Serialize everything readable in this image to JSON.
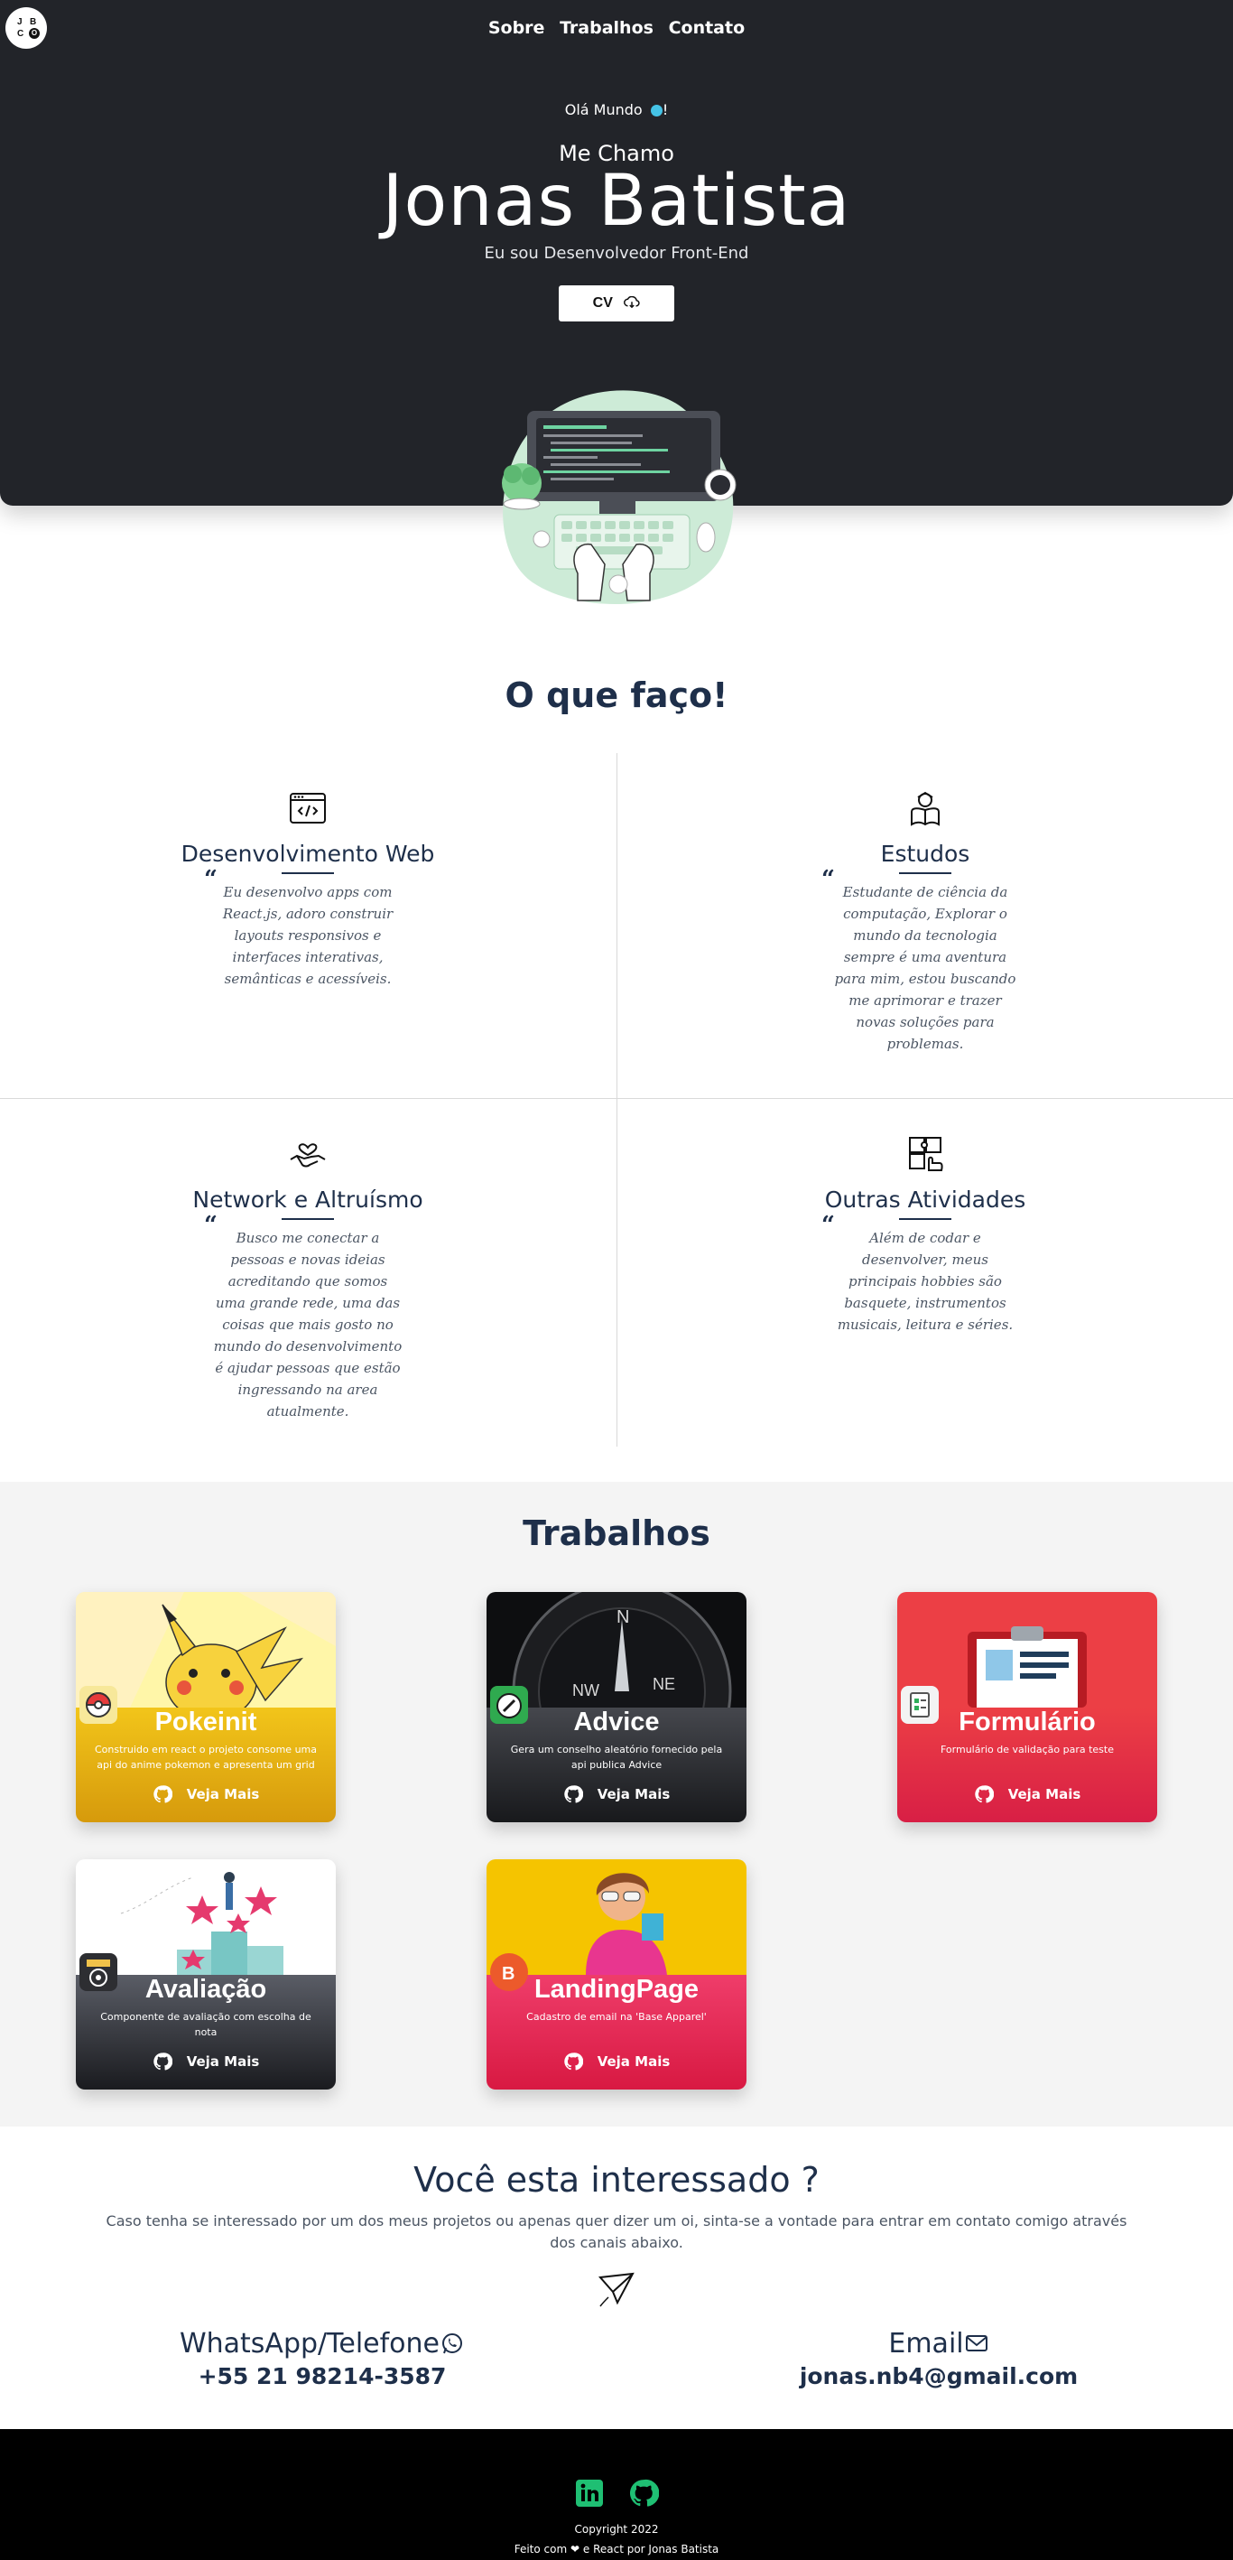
{
  "brand": {
    "logo_letters": [
      "J",
      "B",
      "C",
      "O"
    ]
  },
  "nav": {
    "items": [
      "Sobre",
      "Trabalhos",
      "Contato"
    ]
  },
  "hero": {
    "greeting": "Olá Mundo",
    "greeting_suffix": "!",
    "intro": "Me Chamo",
    "name": "Jonas Batista",
    "role": "Eu sou Desenvolvedor Front-End",
    "cv_label": "CV",
    "colors": {
      "background": "#222429",
      "accent_dot": "#45c3e6"
    }
  },
  "services": {
    "title": "O que faço!",
    "items": [
      {
        "icon": "code-window-icon",
        "title": "Desenvolvimento Web",
        "text": "Eu desenvolvo apps com React.js, adoro construir layouts responsivos e interfaces interativas, semânticas e acessíveis."
      },
      {
        "icon": "student-reading-icon",
        "title": "Estudos",
        "text": "Estudante de ciência da computação, Explorar o mundo da tecnologia sempre é uma aventura para mim, estou buscando me aprimorar e trazer novas soluções para problemas."
      },
      {
        "icon": "handshake-heart-icon",
        "title": "Network e Altruísmo",
        "text": "Busco me conectar a pessoas e novas ideias acreditando que somos uma grande rede, uma das coisas que mais gosto no mundo do desenvolvimento é ajudar pessoas que estão ingressando na area atualmente."
      },
      {
        "icon": "puzzle-hand-icon",
        "title": "Outras Atividades",
        "text": "Além de codar e desenvolver, meus principais hobbies são basquete, instrumentos musicais, leitura e séries."
      }
    ]
  },
  "works": {
    "title": "Trabalhos",
    "more_label": "Veja Mais",
    "items": [
      {
        "title": "Pokeinit",
        "description": "Construido em react o projeto consome uma api do anime pokemon e apresenta um grid",
        "color": "#e0a20c",
        "badge_icon": "pokeball-icon"
      },
      {
        "title": "Advice",
        "description": "Gera um conselho aleatório fornecido pela api publica Advice",
        "color": "#2d2e32",
        "badge_icon": "compass-icon"
      },
      {
        "title": "Formulário",
        "description": "Formulário de validação para teste",
        "color": "#e0334a",
        "badge_icon": "form-icon"
      },
      {
        "title": "Avaliação",
        "description": "Componente de avaliação com escolha de nota",
        "color": "#3a3c44",
        "badge_icon": "rating-icon"
      },
      {
        "title": "LandingPage",
        "description": "Cadastro de email na 'Base Apparel'",
        "color": "#e0334a",
        "badge_icon": "letter-b-icon"
      }
    ]
  },
  "contact": {
    "title": "Você esta interessado ?",
    "text": "Caso tenha se interessado por um dos meus projetos ou apenas quer dizer um oi, sinta-se a vontade para entrar em contato comigo através dos canais abaixo.",
    "phone_label": "WhatsApp/Telefone",
    "phone": "+55 21 98214-3587",
    "email_label": "Email",
    "email": "jonas.nb4@gmail.com"
  },
  "footer": {
    "copyright": "Copyright 2022",
    "made_prefix": "Feito com",
    "made_suffix": "e React por Jonas Batista",
    "social_color": "#1fbf73"
  }
}
